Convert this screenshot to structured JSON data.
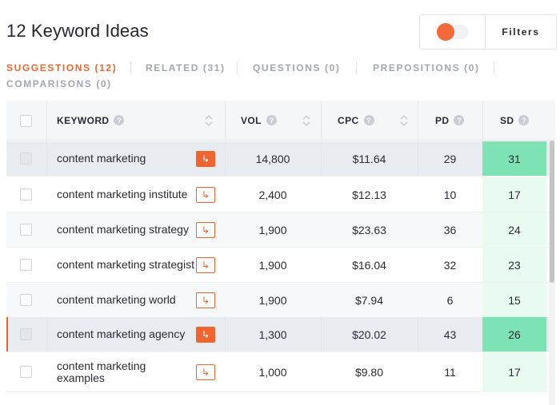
{
  "header": {
    "title": "12 Keyword Ideas",
    "filters_label": "Filters"
  },
  "tabs": [
    {
      "label": "SUGGESTIONS (12)",
      "active": true
    },
    {
      "label": "RELATED (31)",
      "active": false
    },
    {
      "label": "QUESTIONS (0)",
      "active": false
    },
    {
      "label": "PREPOSITIONS (0)",
      "active": false
    },
    {
      "label": "COMPARISONS (0)",
      "active": false
    }
  ],
  "table": {
    "columns": {
      "keyword": "KEYWORD",
      "vol": "VOL",
      "cpc": "CPC",
      "pd": "PD",
      "sd": "SD"
    },
    "help_glyph": "?",
    "rows": [
      {
        "keyword": "content marketing",
        "vol": "14,800",
        "cpc": "$11.64",
        "pd": "29",
        "sd": "31"
      },
      {
        "keyword": "content marketing institute",
        "vol": "2,400",
        "cpc": "$12.13",
        "pd": "10",
        "sd": "17"
      },
      {
        "keyword": "content marketing strategy",
        "vol": "1,900",
        "cpc": "$23.63",
        "pd": "36",
        "sd": "24"
      },
      {
        "keyword": "content marketing strategist",
        "vol": "1,900",
        "cpc": "$16.04",
        "pd": "32",
        "sd": "23"
      },
      {
        "keyword": "content marketing world",
        "vol": "1,900",
        "cpc": "$7.94",
        "pd": "6",
        "sd": "15"
      },
      {
        "keyword": "content marketing agency",
        "vol": "1,300",
        "cpc": "$20.02",
        "pd": "43",
        "sd": "26"
      },
      {
        "keyword": "content marketing examples",
        "vol": "1,000",
        "cpc": "$9.80",
        "pd": "11",
        "sd": "17"
      }
    ]
  },
  "colors": {
    "accent": "#f0652f",
    "sd_low": "#e9fbf1",
    "sd_high": "#7ee3b4"
  },
  "icons": {
    "toggle": "toggle-switch",
    "help": "help-icon",
    "sort": "sort-icon",
    "link": "open-link-icon"
  }
}
